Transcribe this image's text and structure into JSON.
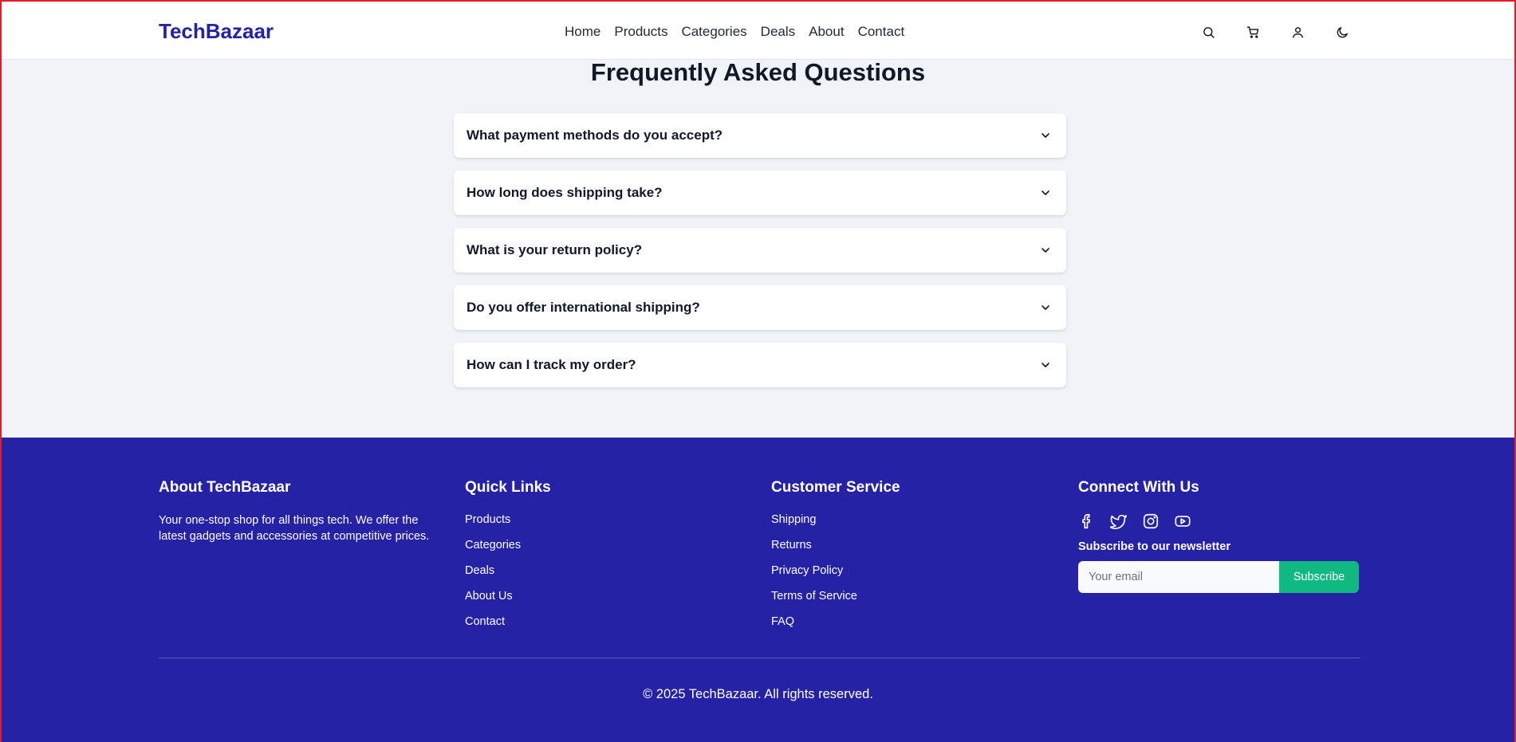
{
  "header": {
    "logo": "TechBazaar",
    "nav": [
      "Home",
      "Products",
      "Categories",
      "Deals",
      "About",
      "Contact"
    ],
    "icons": [
      "search-icon",
      "cart-icon",
      "user-icon",
      "moon-icon"
    ]
  },
  "faq": {
    "title": "Frequently Asked Questions",
    "items": [
      "What payment methods do you accept?",
      "How long does shipping take?",
      "What is your return policy?",
      "Do you offer international shipping?",
      "How can I track my order?"
    ]
  },
  "footer": {
    "about": {
      "title": "About TechBazaar",
      "text": "Your one-stop shop for all things tech. We offer the latest gadgets and accessories at competitive prices."
    },
    "quick_links": {
      "title": "Quick Links",
      "items": [
        "Products",
        "Categories",
        "Deals",
        "About Us",
        "Contact"
      ]
    },
    "customer_service": {
      "title": "Customer Service",
      "items": [
        "Shipping",
        "Returns",
        "Privacy Policy",
        "Terms of Service",
        "FAQ"
      ]
    },
    "connect": {
      "title": "Connect With Us",
      "social_icons": [
        "facebook-icon",
        "twitter-icon",
        "instagram-icon",
        "youtube-icon"
      ],
      "newsletter_label": "Subscribe to our newsletter",
      "email_placeholder": "Your email",
      "subscribe_label": "Subscribe"
    },
    "copyright": "© 2025 TechBazaar. All rights reserved."
  },
  "colors": {
    "brand": "#2522a6",
    "accent": "#10b981",
    "page_background": "#f0f3f7"
  }
}
